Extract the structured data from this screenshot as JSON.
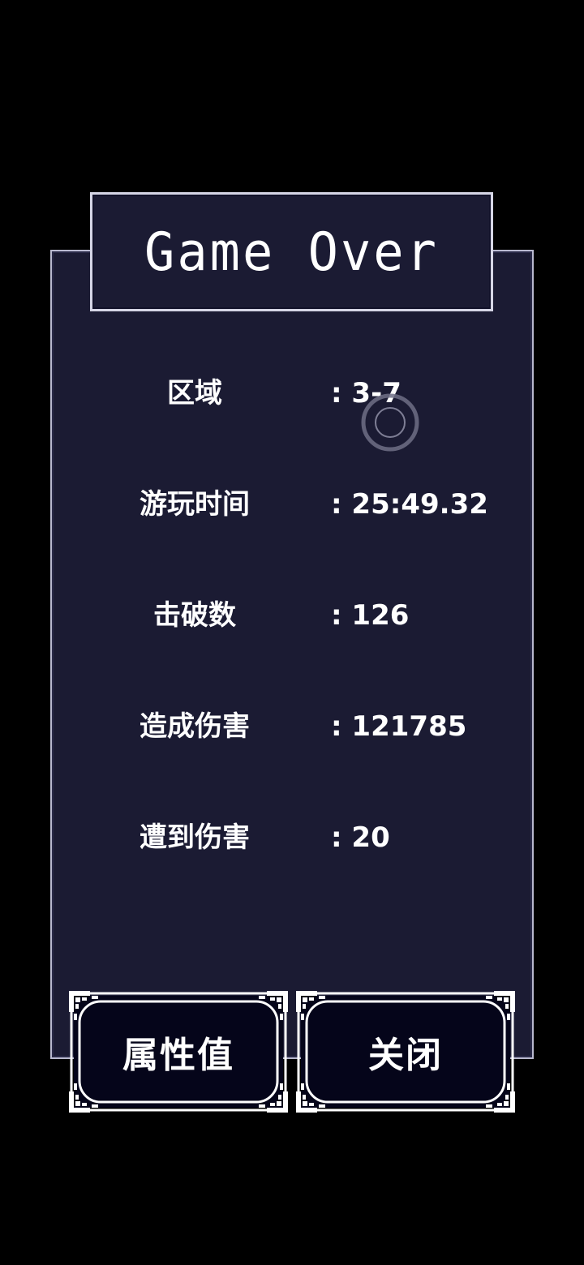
{
  "dialog": {
    "title": "Game Over"
  },
  "stats": [
    {
      "label": "区域",
      "value": ": 3-7"
    },
    {
      "label": "游玩时间",
      "value": ": 25:49.32"
    },
    {
      "label": "击破数",
      "value": ": 126"
    },
    {
      "label": "造成伤害",
      "value": ": 121785"
    },
    {
      "label": "遭到伤害",
      "value": ": 20"
    }
  ],
  "buttons": {
    "attributes_label": "属性值",
    "close_label": "关闭"
  },
  "colors": {
    "background": "#000000",
    "panel": "#1b1b33",
    "border": "#d6d6e6",
    "button_fill": "#05051a",
    "text": "#ffffff"
  },
  "icons": {
    "touch_indicator": "touch-ring-icon",
    "button_frame": "pixel-ornament-frame"
  }
}
